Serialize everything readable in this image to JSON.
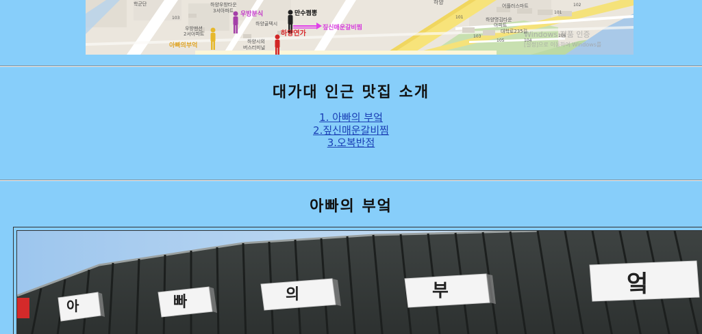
{
  "map": {
    "labels": {
      "l01": "학군단",
      "l02": "하양우방타운",
      "l03": "3서아파트",
      "l04": "하양골텍시",
      "l05": "우방맨션",
      "l06": "2서아파트",
      "l07": "하양시외",
      "l08": "버스터미널",
      "l09": "하양",
      "l10": "어플러스마트",
      "l11": "하양명김타운",
      "l12": "아파트",
      "l13": "대학로235길",
      "l14": "101",
      "l15": "102",
      "l16": "101",
      "l17": "103",
      "l18": "105",
      "l19": "104",
      "l20": "103",
      "l21": "106"
    },
    "markers": {
      "m1": "우방분식",
      "m2": "만수쩜뽕",
      "m3": "짚신매운갈비찜",
      "m4": "하양연가",
      "m5": "아빠의부억"
    },
    "watermark_line1": "Windows 정품 인증",
    "watermark_line2": "[설정]으로 이동하여 Windows를"
  },
  "section_intro": {
    "title": "대가대 인근 맛집 소개",
    "links": [
      "1. 아빠의 부엌",
      "2.짚신매운갈비찜",
      "3.오복반점"
    ]
  },
  "section_restaurant": {
    "title": "아빠의 부엌"
  },
  "photo": {
    "sign_letters": [
      "아",
      "빠",
      "의",
      "부",
      "엌"
    ]
  }
}
